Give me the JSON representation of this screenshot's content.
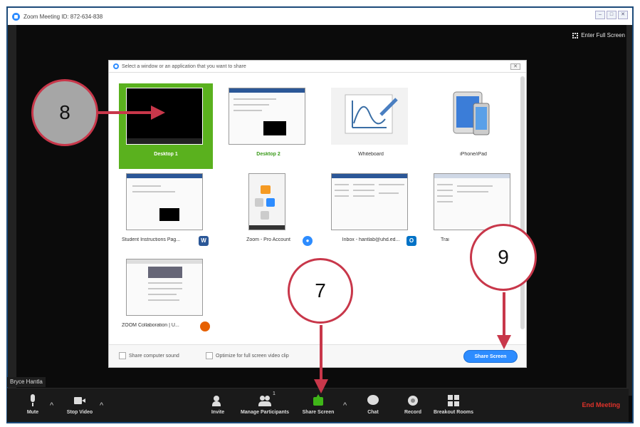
{
  "window": {
    "title": "Zoom Meeting ID: 872-634-838",
    "enter_full_screen": "Enter Full Screen"
  },
  "dialog": {
    "title": "Select a window or an application that you want to share",
    "close_label": "✕",
    "tiles": [
      {
        "label": "Desktop 1"
      },
      {
        "label": "Desktop 2"
      },
      {
        "label": "Whiteboard"
      },
      {
        "label": "iPhone/iPad"
      },
      {
        "label": "Student Instructions Pag..."
      },
      {
        "label": "Zoom - Pro Account"
      },
      {
        "label": "Inbox - hantlab@uhd.ed..."
      },
      {
        "label": "Trai"
      },
      {
        "label": "ZOOM Collaboration | U..."
      }
    ],
    "share_sound_label": "Share computer sound",
    "optimize_label": "Optimize for full screen video clip",
    "share_button_label": "Share Screen"
  },
  "meeting": {
    "participant_name": "Bryce Hantla"
  },
  "toolbar": {
    "mute": "Mute",
    "stop_video": "Stop Video",
    "invite": "Invite",
    "manage_participants": "Manage Participants",
    "participant_count": "1",
    "share_screen": "Share Screen",
    "chat": "Chat",
    "record": "Record",
    "breakout_rooms": "Breakout Rooms",
    "end_meeting": "End Meeting"
  },
  "annotations": {
    "step_8": "8",
    "step_7": "7",
    "step_9": "9",
    "arrow_color": "#c8374a"
  },
  "colors": {
    "zoom_blue": "#2d8cff",
    "selected_green": "#5ab11e",
    "end_red": "#e0322a"
  }
}
